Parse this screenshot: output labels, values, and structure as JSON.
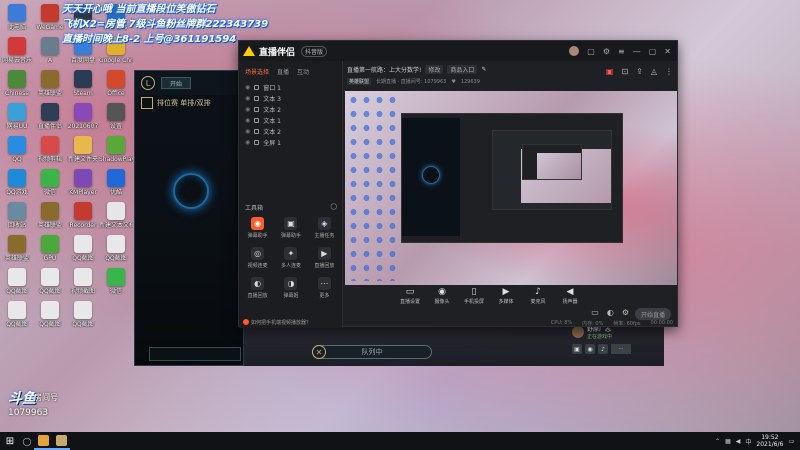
{
  "overlay": {
    "line1": "天天开心哦  当前直播段位笑傲钻石",
    "line2": "飞机X2=房管 7级斗鱼粉丝牌群222343739",
    "line3": "直播时间晚上8-2  上号@361191594"
  },
  "desktop_icons": [
    {
      "label": "此电脑",
      "color": "#3d7bd6"
    },
    {
      "label": "WeGame",
      "color": "#c23b2e"
    },
    {
      "label": "mine",
      "color": "#333"
    },
    {
      "label": "控制面板",
      "color": "#2b6cb5"
    },
    {
      "label": "网易云音乐",
      "color": "#d23a3a"
    },
    {
      "label": "A",
      "color": "#6a7d8e"
    },
    {
      "label": "百度网盘",
      "color": "#3a7ed6"
    },
    {
      "label": "Google Chrome",
      "color": "#e1b12c"
    },
    {
      "label": "Chinese",
      "color": "#4b8a3a"
    },
    {
      "label": "英雄联盟",
      "color": "#8a6b2e"
    },
    {
      "label": "Steam",
      "color": "#2a3b52"
    },
    {
      "label": "Office",
      "color": "#d14a2b"
    },
    {
      "label": "网易UU",
      "color": "#3aa0d6"
    },
    {
      "label": "直播伴侣",
      "color": "#2d3e55"
    },
    {
      "label": "20210607",
      "color": "#8a4ab5"
    },
    {
      "label": "设置",
      "color": "#555"
    },
    {
      "label": "QQ",
      "color": "#2a8ce0"
    },
    {
      "label": "视频剪辑",
      "color": "#d84a4a"
    },
    {
      "label": "新建文件夹",
      "color": "#e8b84a"
    },
    {
      "label": "ShadowPlay",
      "color": "#5ba83a"
    },
    {
      "label": "QQ游戏",
      "color": "#1f8ad8"
    },
    {
      "label": "微信",
      "color": "#3ab54a"
    },
    {
      "label": "KMPlayer",
      "color": "#7d4ab5"
    },
    {
      "label": "优酷",
      "color": "#1f6ad8"
    },
    {
      "label": "回收站",
      "color": "#6a8aa0"
    },
    {
      "label": "英雄联盟",
      "color": "#8a6b2e"
    },
    {
      "label": "Recorder",
      "color": "#c23b2e"
    },
    {
      "label": "新建文本文档",
      "color": "#e6e6e6"
    },
    {
      "label": "英雄联盟",
      "color": "#8a6b2e"
    },
    {
      "label": "GPU",
      "color": "#4ba83a"
    },
    {
      "label": "QQ截图",
      "color": "#e8e8e8"
    },
    {
      "label": "QQ截图",
      "color": "#e8e8e8"
    },
    {
      "label": "QQ截图",
      "color": "#e8e8e8"
    },
    {
      "label": "QQ截图",
      "color": "#e8e8e8"
    },
    {
      "label": "视频截图",
      "color": "#e8e8e8"
    },
    {
      "label": "微信",
      "color": "#3ab54a"
    },
    {
      "label": "QQ截图",
      "color": "#e8e8e8"
    },
    {
      "label": "QQ截图",
      "color": "#e8e8e8"
    },
    {
      "label": "QQ截图",
      "color": "#e8e8e8"
    }
  ],
  "lol_client": {
    "play_label": "开始",
    "mode": "排位赛 单排/双排",
    "queue_label": "队列中"
  },
  "chat": {
    "name": "野原广志",
    "subtitle": "正在游戏中"
  },
  "stream_app": {
    "title": "直播伴侣",
    "edition": "抖音版",
    "scene_tabs": [
      "场景选择",
      "直播",
      "互动"
    ],
    "layers": [
      "窗口 1",
      "文本 3",
      "文本 2",
      "文本 1",
      "文本 2",
      "全屏 1"
    ],
    "tools_title": "工具箱",
    "tools": [
      {
        "label": "弹幕助手",
        "icon": "◉",
        "hot": true
      },
      {
        "label": "弹幕助手",
        "icon": "▣",
        "hot": false
      },
      {
        "label": "主播任务",
        "icon": "◈",
        "hot": false
      },
      {
        "label": "视频连麦",
        "icon": "◎",
        "hot": false
      },
      {
        "label": "多人连麦",
        "icon": "✦",
        "hot": false
      },
      {
        "label": "直播回放",
        "icon": "▶",
        "hot": false
      },
      {
        "label": "直播回放",
        "icon": "◐",
        "hot": false
      },
      {
        "label": "弹幕姬",
        "icon": "◑",
        "hot": false
      },
      {
        "label": "更多",
        "icon": "⋯",
        "hot": false
      }
    ],
    "footer_notice": "如何把手机端视频播放器？",
    "room": {
      "title": "直播第一航路：上大分数学!",
      "tag1": "修改",
      "tag2": "商品入口",
      "category": "英雄联盟",
      "category_sub": "长期直播 · 直播间号: 1079963",
      "viewers": "129639"
    },
    "bottom_tools": [
      {
        "label": "直播设置",
        "icon": "▭"
      },
      {
        "label": "摄像头",
        "icon": "◉"
      },
      {
        "label": "手机投屏",
        "icon": "▯"
      },
      {
        "label": "多媒体",
        "icon": "▶"
      },
      {
        "label": "麦克风",
        "icon": "♪"
      },
      {
        "label": "扬声器",
        "icon": "◀"
      }
    ],
    "start_live": "开始直播",
    "status": [
      "CPU: 8%",
      "内存: 0%",
      "帧率: 60fps",
      "00:00:00"
    ]
  },
  "room_badge": {
    "big": "斗鱼",
    "label": "房间号",
    "number": "1079963"
  },
  "taskbar": {
    "time": "19:52",
    "date": "2021/6/6",
    "lang": "中"
  }
}
